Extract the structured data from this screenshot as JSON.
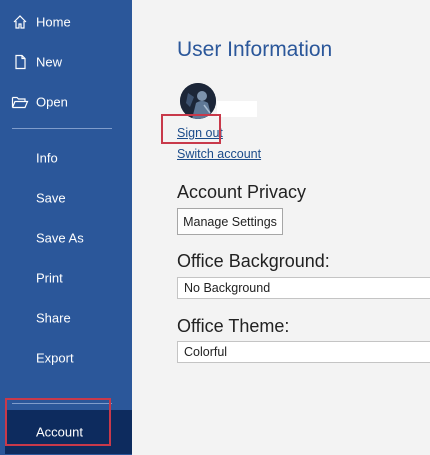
{
  "sidebar": {
    "items": [
      {
        "label": "Home",
        "icon": "home-icon"
      },
      {
        "label": "New",
        "icon": "new-document-icon"
      },
      {
        "label": "Open",
        "icon": "open-folder-icon"
      },
      {
        "label": "Info"
      },
      {
        "label": "Save"
      },
      {
        "label": "Save As"
      },
      {
        "label": "Print"
      },
      {
        "label": "Share"
      },
      {
        "label": "Export"
      },
      {
        "label": "Account"
      }
    ],
    "active_item": "Account"
  },
  "main": {
    "title": "User Information",
    "sign_out": "Sign out",
    "switch_account": "Switch account",
    "account_privacy": {
      "heading": "Account Privacy",
      "button": "Manage Settings"
    },
    "office_background": {
      "heading": "Office Background:",
      "value": "No Background"
    },
    "office_theme": {
      "heading": "Office Theme:",
      "value": "Colorful"
    }
  },
  "colors": {
    "sidebar_bg": "#2b579a",
    "sidebar_active_bg": "#0d2b5e",
    "title_blue": "#2b579a",
    "highlight_red": "#c8394a"
  }
}
